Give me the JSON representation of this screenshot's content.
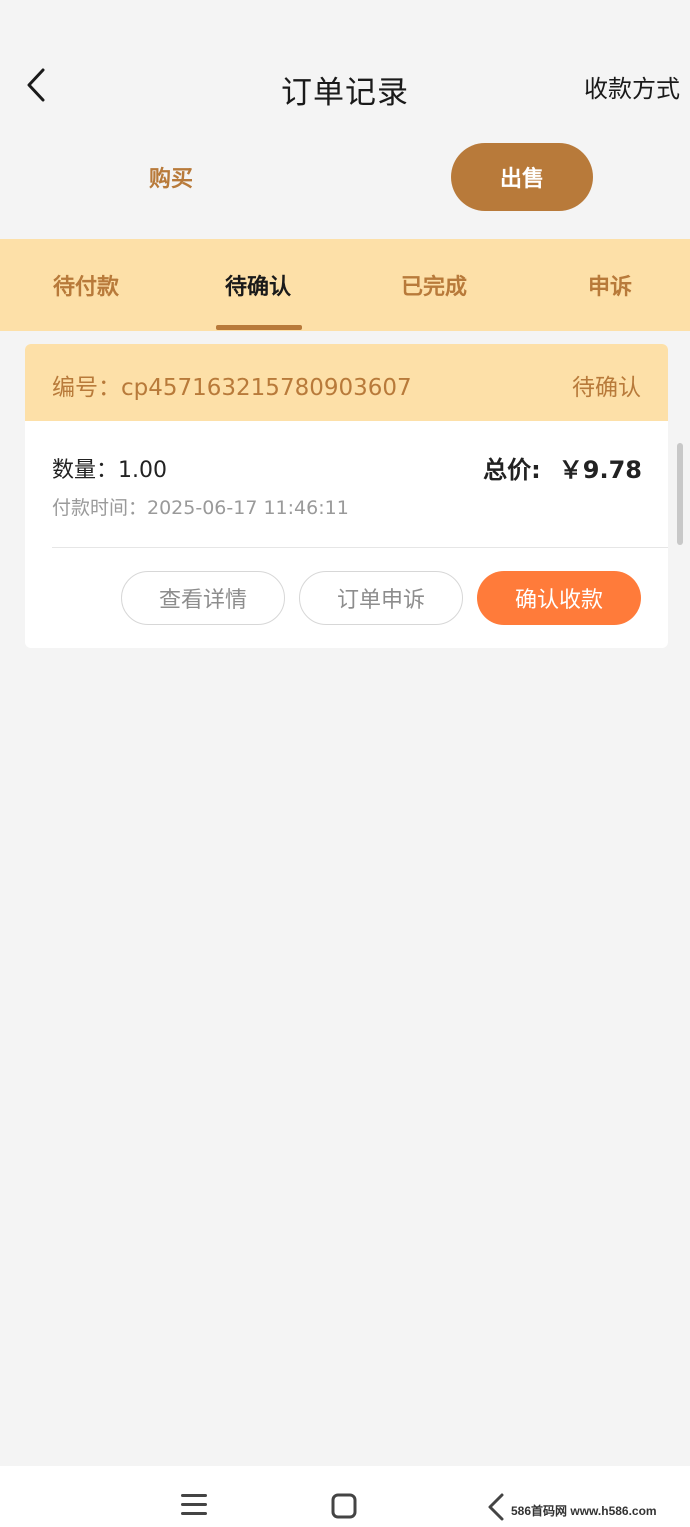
{
  "header": {
    "title": "订单记录",
    "pay_method": "收款方式"
  },
  "mode": {
    "buy": "购买",
    "sell": "出售",
    "selected": "sell"
  },
  "tabs": [
    {
      "label": "待付款",
      "active": false
    },
    {
      "label": "待确认",
      "active": true
    },
    {
      "label": "已完成",
      "active": false
    },
    {
      "label": "申诉",
      "active": false
    }
  ],
  "order": {
    "number_text": "编号：cp457163215780903607",
    "status": "待确认",
    "quantity_text": "数量：1.00",
    "pay_time_text": "付款时间：2025-06-17 11:46:11",
    "total_label": "总价:",
    "total_value": "￥9.78",
    "buttons": {
      "detail": "查看详情",
      "appeal": "订单申诉",
      "confirm": "确认收款"
    }
  },
  "watermark": "586首码网 www.h586.com",
  "colors": {
    "accent": "#b87a3a",
    "tab_bg": "#fde0a8",
    "confirm": "#ff7b3a",
    "page_bg": "#f4f4f4"
  },
  "icons": {
    "back": "chevron-left-icon",
    "nav_menu": "menu-icon",
    "nav_home": "home-square-icon",
    "nav_back": "nav-back-icon"
  }
}
